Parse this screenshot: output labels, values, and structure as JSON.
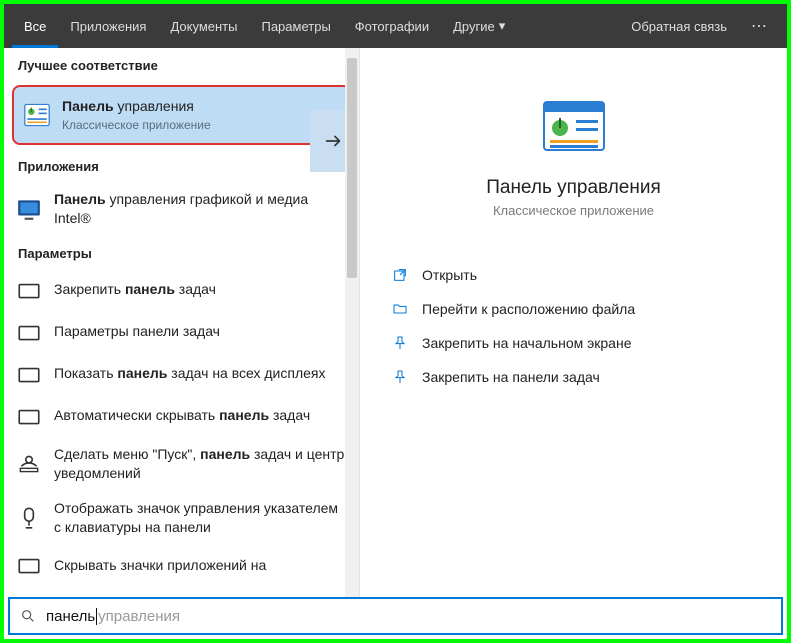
{
  "tabs": {
    "all": "Все",
    "apps": "Приложения",
    "docs": "Документы",
    "settings": "Параметры",
    "photos": "Фотографии",
    "more": "Другие",
    "feedback": "Обратная связь"
  },
  "sections": {
    "best": "Лучшее соответствие",
    "apps": "Приложения",
    "settings": "Параметры"
  },
  "best": {
    "title_pre": "Панель",
    "title_post": " управления",
    "sub": "Классическое приложение"
  },
  "apps_results": [
    {
      "pre": "Панель",
      "post": " управления графикой и медиа Intel®"
    }
  ],
  "settings_results": [
    {
      "text": "Закрепить <b>панель</b> задач"
    },
    {
      "text": "Параметры панели задач"
    },
    {
      "text": "Показать <b>панель</b> задач на всех дисплеях"
    },
    {
      "text": "Автоматически скрывать <b>панель</b> задач"
    },
    {
      "text": "Сделать меню \"Пуск\", <b>панель</b> задач и центр уведомлений"
    },
    {
      "text": "Отображать значок управления указателем с клавиатуры на панели"
    },
    {
      "text": "Скрывать значки приложений на"
    }
  ],
  "preview": {
    "title": "Панель управления",
    "sub": "Классическое приложение"
  },
  "actions": {
    "open": "Открыть",
    "location": "Перейти к расположению файла",
    "pin_start": "Закрепить на начальном экране",
    "pin_taskbar": "Закрепить на панели задач"
  },
  "search": {
    "typed": "панель",
    "suggest": " управления"
  }
}
